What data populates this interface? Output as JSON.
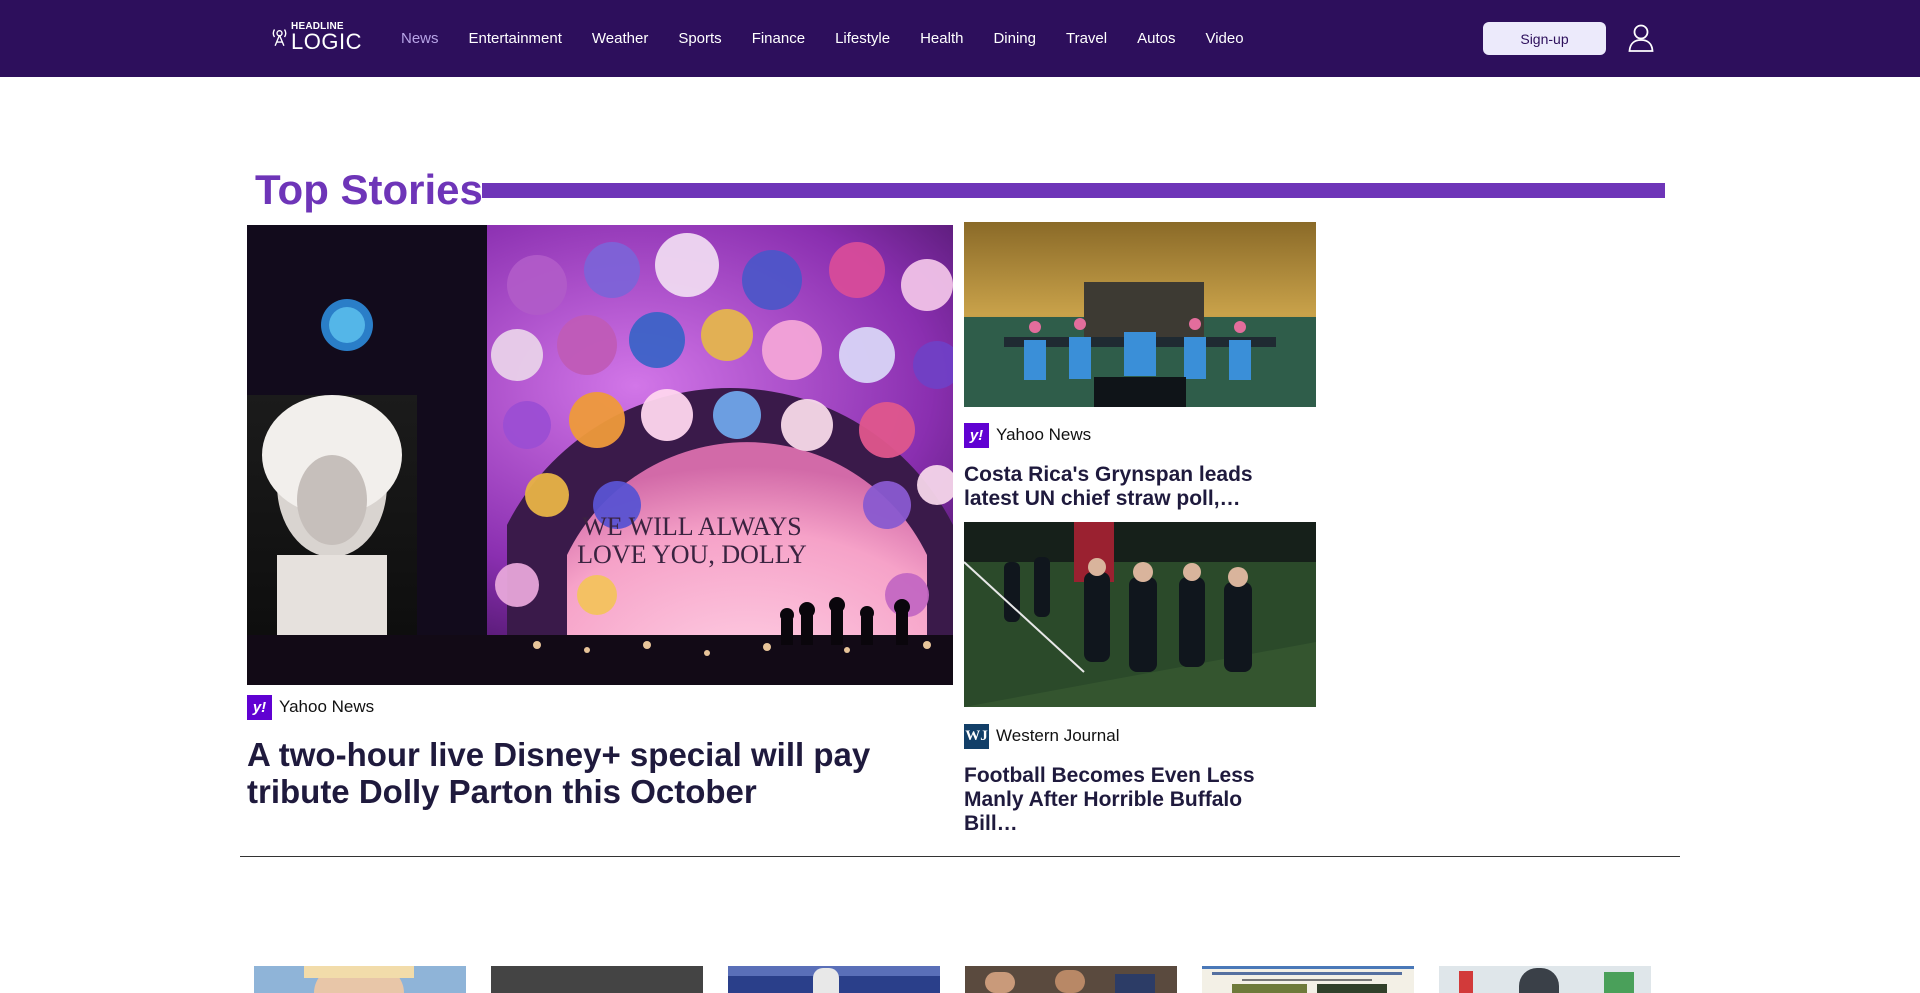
{
  "header": {
    "logo": {
      "small": "HEADLINE",
      "big": "LOGIC"
    },
    "nav": [
      "News",
      "Entertainment",
      "Weather",
      "Sports",
      "Finance",
      "Lifestyle",
      "Health",
      "Dining",
      "Travel",
      "Autos",
      "Video"
    ],
    "active_nav": "News",
    "signup_label": "Sign-up",
    "colors": {
      "bar": "#2d0f5c",
      "active": "#b7a4e6"
    }
  },
  "top_stories": {
    "title": "Top Stories",
    "accent_color": "#6e35b8",
    "main": {
      "source": "Yahoo News",
      "source_icon": "yahoo-logo-icon",
      "headline": "A two-hour live Disney+ special will pay tribute Dolly Parton this October",
      "image_caption_text": [
        "WE WILL ALWAYS",
        "LOVE YOU, DOLLY"
      ]
    },
    "side": [
      {
        "source": "Yahoo News",
        "source_icon": "yahoo-logo-icon",
        "headline": "Costa Rica's Grynspan leads latest UN chief straw poll,…"
      },
      {
        "source": "Western Journal",
        "source_icon": "western-journal-logo-icon",
        "headline": "Football Becomes Even Less Manly After Horrible Buffalo Bill…"
      }
    ]
  },
  "more_stories": {
    "thumbnails": [
      "portrait",
      "dark",
      "football",
      "crowd",
      "document",
      "skier"
    ]
  }
}
